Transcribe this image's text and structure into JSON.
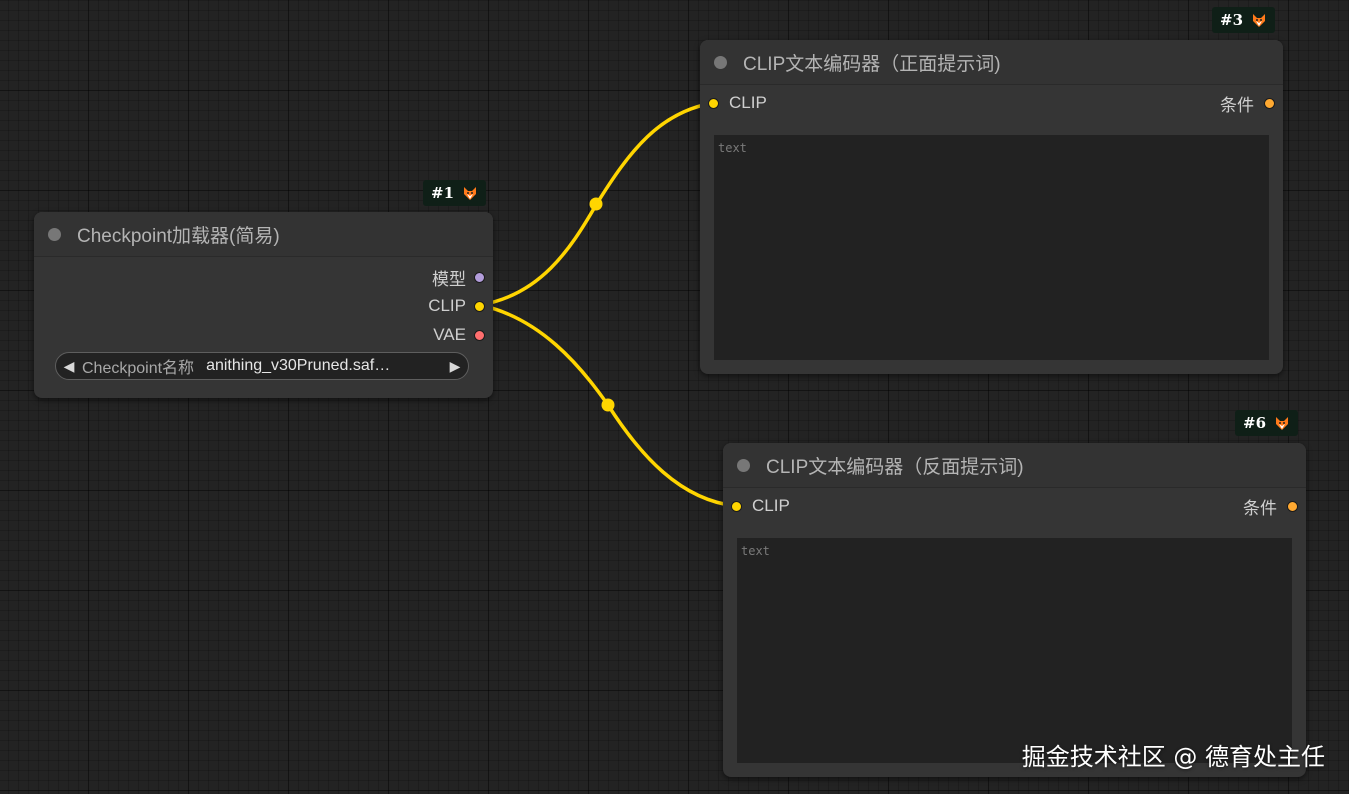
{
  "colors": {
    "clip_link": "#ffd500",
    "model_slot": "#b39ddb",
    "clip_slot": "#ffd500",
    "vae_slot": "#ff6e6e",
    "conditioning_slot": "#ffa931"
  },
  "nodes": {
    "checkpoint": {
      "badge": "#1",
      "badge_icon": "fox-icon",
      "title": "Checkpoint加载器(简易)",
      "outputs": {
        "model": "模型",
        "clip": "CLIP",
        "vae": "VAE"
      },
      "widget": {
        "label": "Checkpoint名称",
        "value": "anithing_v30Pruned.saf…"
      }
    },
    "positive": {
      "badge": "#3",
      "badge_icon": "fox-icon",
      "title": "CLIP文本编码器（正面提示词)",
      "input": "CLIP",
      "output": "条件",
      "placeholder": "text"
    },
    "negative": {
      "badge": "#6",
      "badge_icon": "fox-icon",
      "title": "CLIP文本编码器（反面提示词)",
      "input": "CLIP",
      "output": "条件",
      "placeholder": "text"
    }
  },
  "watermark": "掘金技术社区 @ 德育处主任"
}
